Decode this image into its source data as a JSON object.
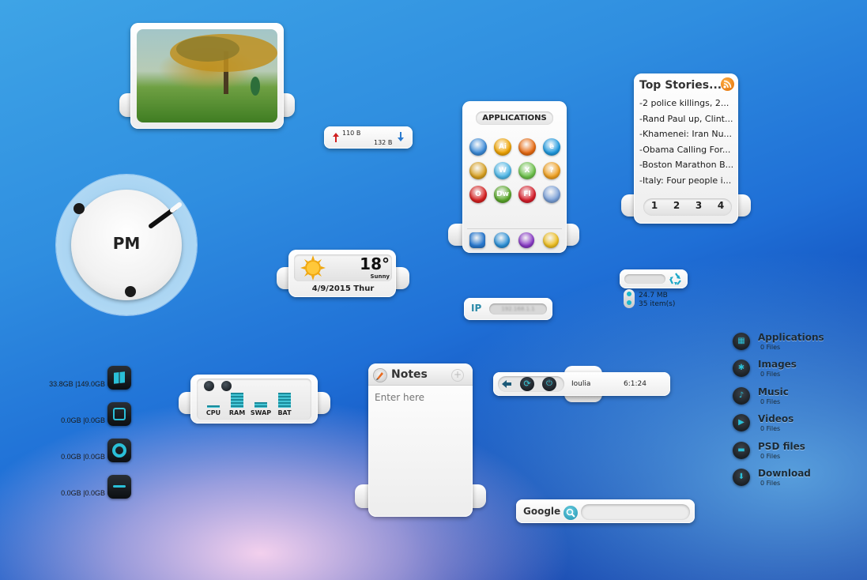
{
  "net_meter": {
    "upload": "110 B",
    "download": "132 B"
  },
  "clock": {
    "period": "PM"
  },
  "weather": {
    "temperature": "18°",
    "condition": "Sunny",
    "date": "4/9/2015 Thur"
  },
  "ip_widget": {
    "label": "IP",
    "value": "192.168.1.1"
  },
  "applications": {
    "title": "APPLICATIONS",
    "apps": [
      {
        "name": "messenger-icon",
        "label": "",
        "color": "#3a8ad8"
      },
      {
        "name": "illustrator-icon",
        "label": "Ai",
        "color": "#f0a400"
      },
      {
        "name": "firefox-icon",
        "label": "",
        "color": "#e86a10"
      },
      {
        "name": "ie-icon",
        "label": "e",
        "color": "#1f9ae0"
      },
      {
        "name": "chrome-icon",
        "label": "",
        "color": "#d8a020"
      },
      {
        "name": "word-icon",
        "label": "W",
        "color": "#4fb8e8"
      },
      {
        "name": "excel-icon",
        "label": "X",
        "color": "#6cc24a"
      },
      {
        "name": "help-icon",
        "label": "?",
        "color": "#f0a020"
      },
      {
        "name": "opera-icon",
        "label": "O",
        "color": "#d82020"
      },
      {
        "name": "dreamweaver-icon",
        "label": "Dw",
        "color": "#5aa82a"
      },
      {
        "name": "flash-icon",
        "label": "Fl",
        "color": "#d81d2a"
      },
      {
        "name": "settings-icon",
        "label": "",
        "color": "#7aa0d8"
      }
    ],
    "dock": [
      {
        "name": "windows-dock-icon",
        "color": "#2a7ad0"
      },
      {
        "name": "globe-dock-icon",
        "color": "#2a90d8"
      },
      {
        "name": "gamepad-dock-icon",
        "color": "#8a3ac8"
      },
      {
        "name": "star-dock-icon",
        "color": "#f0c020"
      }
    ]
  },
  "top_stories": {
    "title": "Top Stories...",
    "items": [
      "-2 police killings, 2...",
      "-Rand Paul up, Clint...",
      "-Khamenei: Iran Nu...",
      "-Obama Calling For...",
      "-Boston Marathon B...",
      "-Italy: Four people i..."
    ],
    "pages": [
      "1",
      "2",
      "3",
      "4"
    ]
  },
  "recycle_bin": {
    "size": "24.7 MB",
    "items": "35 item(s)"
  },
  "drives": [
    {
      "used": "33.8GB",
      "total": "|149.0GB",
      "icon": "windows-drive-icon"
    },
    {
      "used": "0.0GB",
      "total": "|0.0GB",
      "icon": "disk-drive-icon"
    },
    {
      "used": "0.0GB",
      "total": "|0.0GB",
      "icon": "optical-drive-icon"
    },
    {
      "used": "0.0GB",
      "total": "|0.0GB",
      "icon": "usb-drive-icon"
    }
  ],
  "system_meter": {
    "labels": [
      "CPU",
      "RAM",
      "SWAP",
      "BAT"
    ],
    "levels": [
      0.15,
      0.85,
      0.3,
      0.85
    ]
  },
  "notes": {
    "title": "Notes",
    "placeholder": "Enter here"
  },
  "media_player": {
    "title": "Ioulia",
    "time": "6:1:24"
  },
  "google_search": {
    "label": "Google"
  },
  "folders": [
    {
      "name": "Applications",
      "count": "0 Files"
    },
    {
      "name": "Images",
      "count": "0 Files"
    },
    {
      "name": "Music",
      "count": "0 Files"
    },
    {
      "name": "Videos",
      "count": "0 Files"
    },
    {
      "name": "PSD files",
      "count": "0 Files"
    },
    {
      "name": "Download",
      "count": "0 Files"
    }
  ],
  "colors": {
    "accent_teal": "#1ab8cc",
    "upload_arrow": "#d02020",
    "download_arrow": "#2a7ad0"
  }
}
